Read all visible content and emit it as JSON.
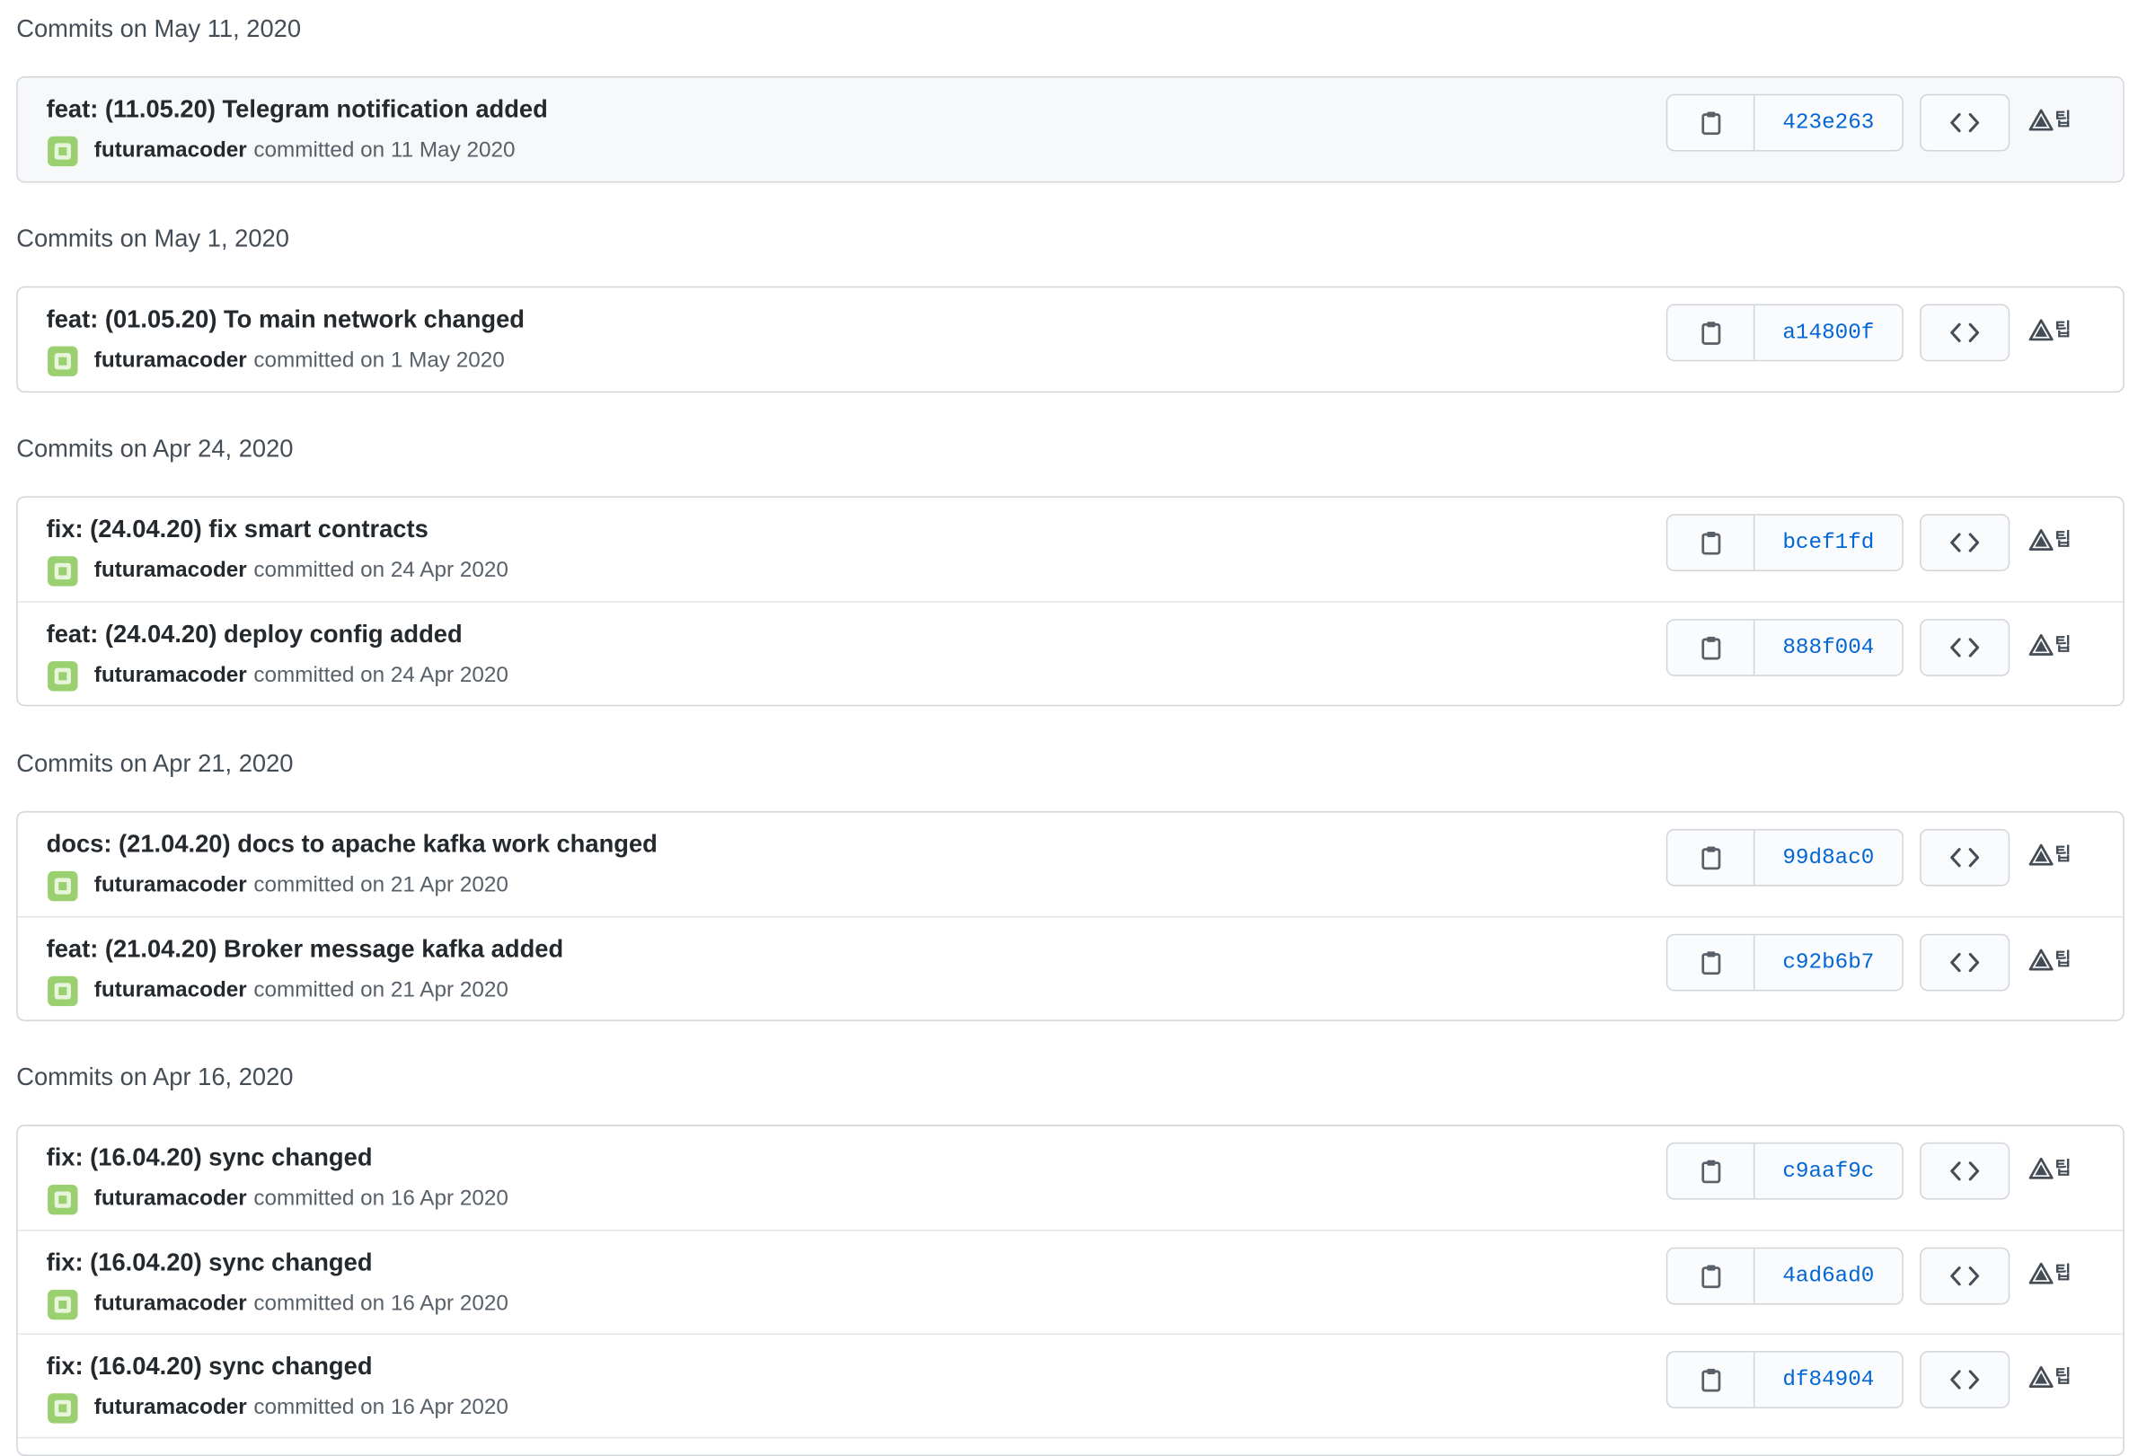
{
  "groups": [
    {
      "header": "Commits on May 11, 2020",
      "commits": [
        {
          "message": "feat: (11.05.20) Telegram notification added",
          "author": "futuramacoder",
          "committed": "committed on 11 May 2020",
          "sha": "423e263",
          "ext_label": "팁"
        }
      ]
    },
    {
      "header": "Commits on May 1, 2020",
      "commits": [
        {
          "message": "feat: (01.05.20) To main network changed",
          "author": "futuramacoder",
          "committed": "committed on 1 May 2020",
          "sha": "a14800f",
          "ext_label": "팁"
        }
      ]
    },
    {
      "header": "Commits on Apr 24, 2020",
      "commits": [
        {
          "message": "fix: (24.04.20) fix smart contracts",
          "author": "futuramacoder",
          "committed": "committed on 24 Apr 2020",
          "sha": "bcef1fd",
          "ext_label": "팁"
        },
        {
          "message": "feat: (24.04.20) deploy config added",
          "author": "futuramacoder",
          "committed": "committed on 24 Apr 2020",
          "sha": "888f004",
          "ext_label": "팁"
        }
      ]
    },
    {
      "header": "Commits on Apr 21, 2020",
      "commits": [
        {
          "message": "docs: (21.04.20) docs to apache kafka work changed",
          "author": "futuramacoder",
          "committed": "committed on 21 Apr 2020",
          "sha": "99d8ac0",
          "ext_label": "팁"
        },
        {
          "message": "feat: (21.04.20) Broker message kafka added",
          "author": "futuramacoder",
          "committed": "committed on 21 Apr 2020",
          "sha": "c92b6b7",
          "ext_label": "팁"
        }
      ]
    },
    {
      "header": "Commits on Apr 16, 2020",
      "commits": [
        {
          "message": "fix: (16.04.20) sync changed",
          "author": "futuramacoder",
          "committed": "committed on 16 Apr 2020",
          "sha": "c9aaf9c",
          "ext_label": "팁"
        },
        {
          "message": "fix: (16.04.20) sync changed",
          "author": "futuramacoder",
          "committed": "committed on 16 Apr 2020",
          "sha": "4ad6ad0",
          "ext_label": "팁"
        },
        {
          "message": "fix: (16.04.20) sync changed",
          "author": "futuramacoder",
          "committed": "committed on 16 Apr 2020",
          "sha": "df84904",
          "ext_label": "팁"
        }
      ]
    }
  ],
  "icons": {
    "copy": "clipboard-icon",
    "browse": "code-brackets-icon",
    "extension": "warning-triangle-icon"
  },
  "colors": {
    "sha_link": "#0366d6",
    "avatar_green": "#9ad070",
    "border": "#d1d5da",
    "highlight_row": "#f6f8fa"
  }
}
